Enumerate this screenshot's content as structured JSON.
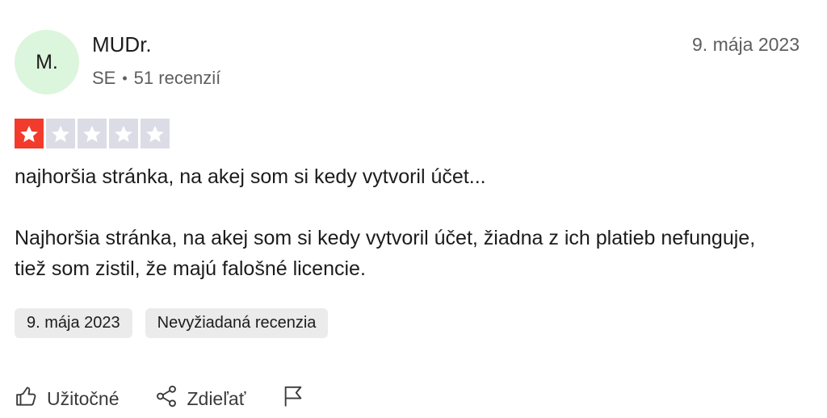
{
  "reviewer": {
    "initials": "M.",
    "name": "MUDr.",
    "country": "SE",
    "separator": "•",
    "review_count": "51 recenzií"
  },
  "review": {
    "date_top": "9. mája 2023",
    "rating": 1,
    "rating_max": 5,
    "title": "najhoršia stránka, na akej som si kedy vytvoril účet...",
    "body": "Najhoršia stránka, na akej som si kedy vytvoril účet, žiadna z ich platieb nefunguje, tiež som zistil, že majú falošné licencie.",
    "tags": [
      "9. mája 2023",
      "Nevyžiadaná recenzia"
    ]
  },
  "actions": {
    "useful_label": "Užitočné",
    "share_label": "Zdieľať",
    "report_icon": "flag-icon"
  },
  "colors": {
    "star_filled": "#f23b2c",
    "star_empty": "#dcdce6",
    "avatar_bg": "#dcf5dd",
    "tag_bg": "#ebebeb"
  }
}
